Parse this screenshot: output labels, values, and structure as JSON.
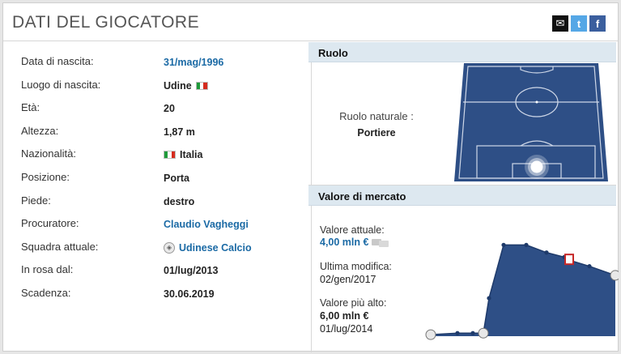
{
  "header": {
    "title": "DATI DEL GIOCATORE",
    "share": {
      "mail_glyph": "✉",
      "twitter_glyph": "t",
      "facebook_glyph": "f"
    }
  },
  "details": [
    {
      "label": "Data di nascita:",
      "value": "31/mag/1996",
      "link": true
    },
    {
      "label": "Luogo di nascita:",
      "value": "Udine",
      "flag": "italy-flag"
    },
    {
      "label": "Età:",
      "value": "20"
    },
    {
      "label": "Altezza:",
      "value": "1,87 m"
    },
    {
      "label": "Nazionalità:",
      "value": "Italia",
      "flag": "italy-flag"
    },
    {
      "label": "Posizione:",
      "value": "Porta"
    },
    {
      "label": "Piede:",
      "value": "destro"
    },
    {
      "label": "Procuratore:",
      "value": "Claudio Vagheggi",
      "link": true
    },
    {
      "label": "Squadra attuale:",
      "value": "Udinese Calcio",
      "link": true,
      "crest": "club-crest-icon"
    },
    {
      "label": "In rosa dal:",
      "value": "01/lug/2013"
    },
    {
      "label": "Scadenza:",
      "value": "30.06.2019"
    }
  ],
  "ruolo": {
    "title": "Ruolo",
    "label": "Ruolo naturale :",
    "value": "Portiere",
    "pitch_color": "#2e4f86"
  },
  "mercato": {
    "title": "Valore di mercato",
    "current_label": "Valore attuale:",
    "current_value": "4,00 mln €",
    "last_change_label": "Ultima modifica:",
    "last_change_value": "02/gen/2017",
    "highest_label": "Valore più alto:",
    "highest_value": "6,00 mln €",
    "highest_date": "01/lug/2014"
  },
  "colors": {
    "accent_link": "#1b6aa5",
    "chart_fill": "#2e4f86",
    "section_header": "#dde8f0"
  },
  "chart_data": {
    "type": "area",
    "title": "",
    "xlabel": "",
    "ylabel": "",
    "ylim": [
      0,
      6.5
    ],
    "points": [
      {
        "y": 0.1,
        "marker": "club-crest"
      },
      {
        "y": 0.2
      },
      {
        "y": 0.2
      },
      {
        "y": 0.2,
        "marker": "club-crest"
      },
      {
        "y": 2.5
      },
      {
        "y": 6.0
      },
      {
        "y": 6.0
      },
      {
        "y": 5.5
      },
      {
        "y": 5.2
      },
      {
        "y": 5.0,
        "marker": "club-badge-red"
      },
      {
        "y": 4.6
      },
      {
        "y": 4.0,
        "marker": "club-crest"
      }
    ],
    "grid": false,
    "legend": "none"
  }
}
